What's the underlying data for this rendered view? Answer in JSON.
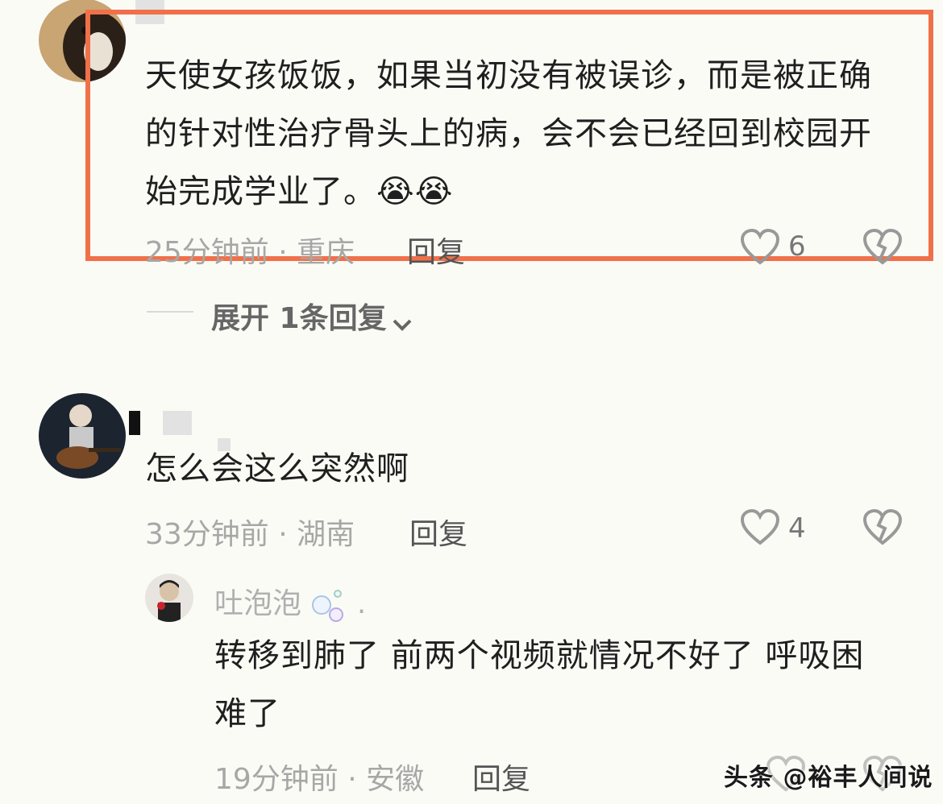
{
  "comments": [
    {
      "text": "天使女孩饭饭，如果当初没有被误诊，而是被正确的针对性治疗骨头上的病，会不会已经回到校园开始完成学业了。😭😭",
      "time": "25分钟前",
      "location": "重庆",
      "reply_label": "回复",
      "likes": "6",
      "expand_label": "展开 1条回复"
    },
    {
      "text": "怎么会这么突然啊",
      "time": "33分钟前",
      "location": "湖南",
      "reply_label": "回复",
      "likes": "4",
      "reply": {
        "nickname": "吐泡泡",
        "text": "转移到肺了 前两个视频就情况不好了 呼吸困难了",
        "time": "19分钟前",
        "location": "安徽",
        "reply_label": "回复"
      }
    }
  ],
  "watermark": "头条 @裕丰人间说",
  "colors": {
    "highlight": "#f0704a",
    "meta": "#a7a7a7",
    "background": "#fbfbf6"
  },
  "icons": [
    "heart-icon",
    "dislike-heart-icon",
    "chevron-down-icon",
    "bubble-icon"
  ]
}
